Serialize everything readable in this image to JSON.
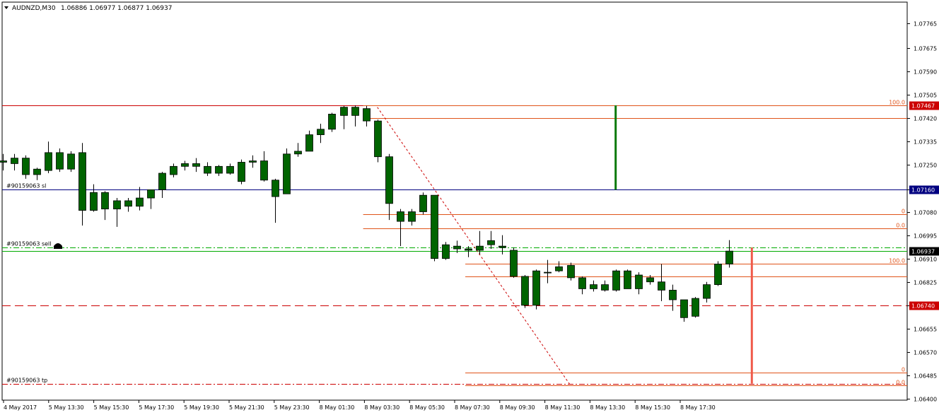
{
  "header": {
    "symbol": "AUDNZD,M30",
    "ohlc": "1.06886 1.06977 1.06877 1.06937"
  },
  "colors": {
    "bull": "#006400",
    "bear": "#006400",
    "wick": "#000000",
    "fib": "#e0541a",
    "sl": "#000080",
    "tp_line": "#cc0000",
    "entry_line": "#00aa00",
    "price_label_bg": "#000000",
    "red_label_bg": "#cc0000",
    "axis": "#000000"
  },
  "chart_data": {
    "type": "candlestick",
    "price_axis": {
      "min": 1.064,
      "max": 1.0785,
      "ticks": [
        "1.07765",
        "1.07675",
        "1.07590",
        "1.07505",
        "1.07420",
        "1.07335",
        "1.07250",
        "1.07160",
        "1.07080",
        "1.06995",
        "1.06910",
        "1.06825",
        "1.06740",
        "1.06655",
        "1.06570",
        "1.06485",
        "1.06400"
      ]
    },
    "time_labels": [
      "4 May 2017",
      "5 May 13:30",
      "5 May 15:30",
      "5 May 17:30",
      "5 May 19:30",
      "5 May 21:30",
      "5 May 23:30",
      "8 May 01:30",
      "8 May 03:30",
      "8 May 05:30",
      "8 May 07:30",
      "8 May 09:30",
      "8 May 11:30",
      "8 May 13:30",
      "8 May 15:30",
      "8 May 17:30"
    ],
    "candles": [
      {
        "o": 1.0726,
        "h": 1.0729,
        "l": 1.0723,
        "c": 1.07265
      },
      {
        "o": 1.07255,
        "h": 1.0729,
        "l": 1.0723,
        "c": 1.07275
      },
      {
        "o": 1.07275,
        "h": 1.07285,
        "l": 1.072,
        "c": 1.07215
      },
      {
        "o": 1.07215,
        "h": 1.0724,
        "l": 1.07195,
        "c": 1.07235
      },
      {
        "o": 1.0723,
        "h": 1.07335,
        "l": 1.0722,
        "c": 1.07295
      },
      {
        "o": 1.07295,
        "h": 1.0731,
        "l": 1.07225,
        "c": 1.07235
      },
      {
        "o": 1.07235,
        "h": 1.073,
        "l": 1.07225,
        "c": 1.0729
      },
      {
        "o": 1.07295,
        "h": 1.0733,
        "l": 1.0703,
        "c": 1.07085
      },
      {
        "o": 1.07085,
        "h": 1.0718,
        "l": 1.0708,
        "c": 1.0715
      },
      {
        "o": 1.0715,
        "h": 1.07155,
        "l": 1.0705,
        "c": 1.0709
      },
      {
        "o": 1.0709,
        "h": 1.0713,
        "l": 1.07025,
        "c": 1.0712
      },
      {
        "o": 1.0712,
        "h": 1.0713,
        "l": 1.0708,
        "c": 1.071
      },
      {
        "o": 1.071,
        "h": 1.0717,
        "l": 1.07085,
        "c": 1.0713
      },
      {
        "o": 1.0713,
        "h": 1.0716,
        "l": 1.0709,
        "c": 1.0716
      },
      {
        "o": 1.0716,
        "h": 1.07225,
        "l": 1.0713,
        "c": 1.0722
      },
      {
        "o": 1.07215,
        "h": 1.07255,
        "l": 1.07205,
        "c": 1.07245
      },
      {
        "o": 1.07245,
        "h": 1.07265,
        "l": 1.0723,
        "c": 1.07255
      },
      {
        "o": 1.07255,
        "h": 1.07275,
        "l": 1.07225,
        "c": 1.07245
      },
      {
        "o": 1.07245,
        "h": 1.0726,
        "l": 1.0721,
        "c": 1.0722
      },
      {
        "o": 1.0722,
        "h": 1.0725,
        "l": 1.0721,
        "c": 1.07245
      },
      {
        "o": 1.07245,
        "h": 1.07255,
        "l": 1.07215,
        "c": 1.0722
      },
      {
        "o": 1.0719,
        "h": 1.0727,
        "l": 1.0718,
        "c": 1.0726
      },
      {
        "o": 1.0726,
        "h": 1.07285,
        "l": 1.0724,
        "c": 1.07265
      },
      {
        "o": 1.07265,
        "h": 1.073,
        "l": 1.0719,
        "c": 1.07195
      },
      {
        "o": 1.07195,
        "h": 1.072,
        "l": 1.0704,
        "c": 1.07135
      },
      {
        "o": 1.07145,
        "h": 1.0731,
        "l": 1.07145,
        "c": 1.0729
      },
      {
        "o": 1.0729,
        "h": 1.0733,
        "l": 1.0728,
        "c": 1.073
      },
      {
        "o": 1.073,
        "h": 1.07375,
        "l": 1.073,
        "c": 1.0736
      },
      {
        "o": 1.0736,
        "h": 1.074,
        "l": 1.0733,
        "c": 1.0738
      },
      {
        "o": 1.0738,
        "h": 1.0744,
        "l": 1.0737,
        "c": 1.07435
      },
      {
        "o": 1.0743,
        "h": 1.07465,
        "l": 1.0738,
        "c": 1.0746
      },
      {
        "o": 1.0746,
        "h": 1.07467,
        "l": 1.0739,
        "c": 1.0743
      },
      {
        "o": 1.07455,
        "h": 1.07465,
        "l": 1.0739,
        "c": 1.0741
      },
      {
        "o": 1.0741,
        "h": 1.07415,
        "l": 1.0726,
        "c": 1.0728
      },
      {
        "o": 1.0728,
        "h": 1.0729,
        "l": 1.0705,
        "c": 1.0711
      },
      {
        "o": 1.0708,
        "h": 1.0709,
        "l": 1.06955,
        "c": 1.07045
      },
      {
        "o": 1.0708,
        "h": 1.0709,
        "l": 1.0703,
        "c": 1.07045
      },
      {
        "o": 1.0708,
        "h": 1.0715,
        "l": 1.0707,
        "c": 1.0714
      },
      {
        "o": 1.0714,
        "h": 1.0714,
        "l": 1.069,
        "c": 1.0691
      },
      {
        "o": 1.0691,
        "h": 1.0697,
        "l": 1.06905,
        "c": 1.0696
      },
      {
        "o": 1.06955,
        "h": 1.06975,
        "l": 1.0693,
        "c": 1.06945
      },
      {
        "o": 1.06945,
        "h": 1.06955,
        "l": 1.06915,
        "c": 1.0694
      },
      {
        "o": 1.0694,
        "h": 1.0701,
        "l": 1.06925,
        "c": 1.06955
      },
      {
        "o": 1.0696,
        "h": 1.0701,
        "l": 1.06945,
        "c": 1.06975
      },
      {
        "o": 1.06955,
        "h": 1.06995,
        "l": 1.06925,
        "c": 1.0695
      },
      {
        "o": 1.0694,
        "h": 1.0695,
        "l": 1.0684,
        "c": 1.06845
      },
      {
        "o": 1.06845,
        "h": 1.0685,
        "l": 1.0673,
        "c": 1.0674
      },
      {
        "o": 1.0674,
        "h": 1.0687,
        "l": 1.06725,
        "c": 1.06865
      },
      {
        "o": 1.0686,
        "h": 1.06905,
        "l": 1.0682,
        "c": 1.0686
      },
      {
        "o": 1.06865,
        "h": 1.069,
        "l": 1.0686,
        "c": 1.0688
      },
      {
        "o": 1.06885,
        "h": 1.06895,
        "l": 1.0683,
        "c": 1.0684
      },
      {
        "o": 1.0684,
        "h": 1.06845,
        "l": 1.0678,
        "c": 1.068
      },
      {
        "o": 1.068,
        "h": 1.0683,
        "l": 1.0679,
        "c": 1.06815
      },
      {
        "o": 1.06815,
        "h": 1.0683,
        "l": 1.0679,
        "c": 1.06795
      },
      {
        "o": 1.06795,
        "h": 1.0687,
        "l": 1.0679,
        "c": 1.06865
      },
      {
        "o": 1.06865,
        "h": 1.0687,
        "l": 1.068,
        "c": 1.068
      },
      {
        "o": 1.068,
        "h": 1.0686,
        "l": 1.0678,
        "c": 1.0685
      },
      {
        "o": 1.0684,
        "h": 1.0685,
        "l": 1.06815,
        "c": 1.06825
      },
      {
        "o": 1.06825,
        "h": 1.0689,
        "l": 1.06755,
        "c": 1.06795
      },
      {
        "o": 1.06795,
        "h": 1.06815,
        "l": 1.0672,
        "c": 1.0676
      },
      {
        "o": 1.0676,
        "h": 1.0676,
        "l": 1.0668,
        "c": 1.06695
      },
      {
        "o": 1.067,
        "h": 1.0677,
        "l": 1.06695,
        "c": 1.06765
      },
      {
        "o": 1.06765,
        "h": 1.06825,
        "l": 1.0675,
        "c": 1.06815
      },
      {
        "o": 1.06815,
        "h": 1.069,
        "l": 1.0681,
        "c": 1.0689
      },
      {
        "o": 1.0689,
        "h": 1.06977,
        "l": 1.06877,
        "c": 1.06937
      }
    ],
    "hlines": [
      {
        "price": 1.07467,
        "color": "#cc0000",
        "style": "solid",
        "x0": 0,
        "label_right": "1.07467",
        "label_bg": "#cc0000",
        "label_fg": "#ffffff"
      },
      {
        "price": 1.0716,
        "color": "#000080",
        "style": "solid",
        "x0": 0,
        "label_right": "1.07160",
        "label_bg": "#000080",
        "label_fg": "#ffffff",
        "label_left": "#90159063 sl"
      },
      {
        "price": 1.0695,
        "color": "#00aa00",
        "style": "dashdot",
        "x0": 0,
        "label_left": "#90159063 sell"
      },
      {
        "price": 1.06937,
        "color": "#00aa00",
        "style": "solid-thin",
        "x0": 0,
        "label_right": "1.06937",
        "label_bg": "#000000",
        "label_fg": "#ffffff"
      },
      {
        "price": 1.0674,
        "color": "#cc0000",
        "style": "longdash",
        "x0": 0,
        "label_right": "1.06740",
        "label_bg": "#cc0000",
        "label_fg": "#ffffff"
      },
      {
        "price": 1.06455,
        "color": "#cc0000",
        "style": "dashdot",
        "x0": 0,
        "label_left": "#90159063 tp"
      }
    ],
    "fib_top": {
      "x_start_index": 32,
      "levels": [
        {
          "price": 1.07467,
          "text": "100.0"
        },
        {
          "price": 1.0742,
          "text": ""
        },
        {
          "price": 1.0707,
          "text": "0"
        },
        {
          "price": 1.0702,
          "text": "0.0"
        }
      ]
    },
    "fib_bottom": {
      "x_start_index": 41,
      "levels": [
        {
          "price": 1.0689,
          "text": "100.0"
        },
        {
          "price": 1.06845,
          "text": ""
        },
        {
          "price": 1.06495,
          "text": "0"
        },
        {
          "price": 1.0645,
          "text": "0.0"
        }
      ]
    },
    "trend_dashed": {
      "from_index": 33,
      "from_price": 1.0746,
      "to_index": 50,
      "to_price": 1.0645
    },
    "vbar_green": {
      "index": 54,
      "top": 1.07467,
      "bottom": 1.0716
    },
    "vbar_red": {
      "index": 66,
      "top": 1.0695,
      "bottom": 1.06455
    }
  }
}
